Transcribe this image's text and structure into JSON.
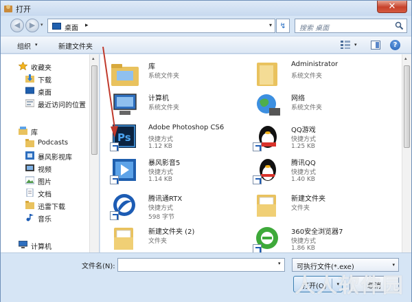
{
  "window": {
    "title": "打开",
    "close_glyph": "✕"
  },
  "address": {
    "location": "桌面",
    "separator": "▸",
    "dropdown_glyph": "▾",
    "refresh_glyph": "↯",
    "search_placeholder": "搜索 桌面"
  },
  "nav_glyphs": {
    "back": "◀",
    "forward": "▶",
    "dropdown": "▾"
  },
  "toolbar": {
    "organize": "组织",
    "organize_arrow": "▾",
    "new_folder": "新建文件夹",
    "view_arrow": "▾",
    "help": "?"
  },
  "sidebar": {
    "favorites_label": "收藏夹",
    "favorites": [
      "下载",
      "桌面",
      "最近访问的位置"
    ],
    "libraries_label": "库",
    "libraries": [
      "Podcasts",
      "暴风影视库",
      "视频",
      "图片",
      "文档",
      "迅雷下载",
      "音乐"
    ],
    "computer_label": "计算机",
    "scroll_up": "▴"
  },
  "files": [
    {
      "name": "库",
      "type": "系统文件夹",
      "size": ""
    },
    {
      "name": "Administrator",
      "type": "系统文件夹",
      "size": ""
    },
    {
      "name": "计算机",
      "type": "系统文件夹",
      "size": ""
    },
    {
      "name": "网络",
      "type": "系统文件夹",
      "size": ""
    },
    {
      "name": "Adobe Photoshop CS6",
      "type": "快捷方式",
      "size": "1.12 KB"
    },
    {
      "name": "QQ游戏",
      "type": "快捷方式",
      "size": "1.25 KB"
    },
    {
      "name": "暴风影音5",
      "type": "快捷方式",
      "size": "1.14 KB"
    },
    {
      "name": "腾讯QQ",
      "type": "快捷方式",
      "size": "1.40 KB"
    },
    {
      "name": "腾讯通RTX",
      "type": "快捷方式",
      "size": "598 字节"
    },
    {
      "name": "新建文件夹",
      "type": "文件夹",
      "size": ""
    },
    {
      "name": "新建文件夹 (2)",
      "type": "文件夹",
      "size": ""
    },
    {
      "name": "360安全浏览器7",
      "type": "快捷方式",
      "size": "1.86 KB"
    }
  ],
  "footer": {
    "filename_label": "文件名(N):",
    "filename_value": "",
    "filename_drop": "▾",
    "filter": "可执行文件(*.exe)",
    "filter_drop": "▾",
    "open": "打开(O)",
    "open_arrow": "▾",
    "cancel": "取消"
  },
  "watermark": "人人软件园",
  "colors": {
    "accent": "#1d5cb4",
    "window_bg": "#d6e5f5",
    "annotation_arrow": "#c0392b"
  }
}
